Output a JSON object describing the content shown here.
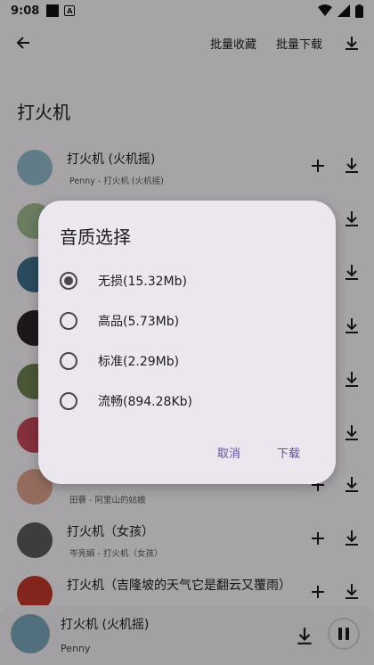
{
  "statusbar": {
    "time": "9:08",
    "mark": "A"
  },
  "topbar": {
    "collect_label": "批量收藏",
    "download_label": "批量下载"
  },
  "page_title": "打火机",
  "songs": [
    {
      "title": "打火机 (火机摇)",
      "subtitle": "Penny - 打火机 (火机摇)"
    },
    {
      "title": "",
      "subtitle": ""
    },
    {
      "title": "",
      "subtitle": ""
    },
    {
      "title": "",
      "subtitle": ""
    },
    {
      "title": "",
      "subtitle": ""
    },
    {
      "title": "",
      "subtitle": ""
    },
    {
      "title": "",
      "subtitle": "田蓑 - 阿里山的姑娘"
    },
    {
      "title": "打火机（女孩）",
      "subtitle": "岑亮娟 - 打火机（女孩）"
    },
    {
      "title": "打火机（吉隆坡的天气它是翻云又覆雨）",
      "subtitle": ""
    }
  ],
  "dialog": {
    "title": "音质选择",
    "options": [
      {
        "label": "无损(15.32Mb)",
        "selected": true
      },
      {
        "label": "高品(5.73Mb)",
        "selected": false
      },
      {
        "label": "标准(2.29Mb)",
        "selected": false
      },
      {
        "label": "流畅(894.28Kb)",
        "selected": false
      }
    ],
    "cancel_label": "取消",
    "confirm_label": "下载"
  },
  "player": {
    "title": "打火机 (火机摇)",
    "artist": "Penny"
  },
  "colors": {
    "accent": "#6750a4",
    "scrim": "#000000"
  }
}
